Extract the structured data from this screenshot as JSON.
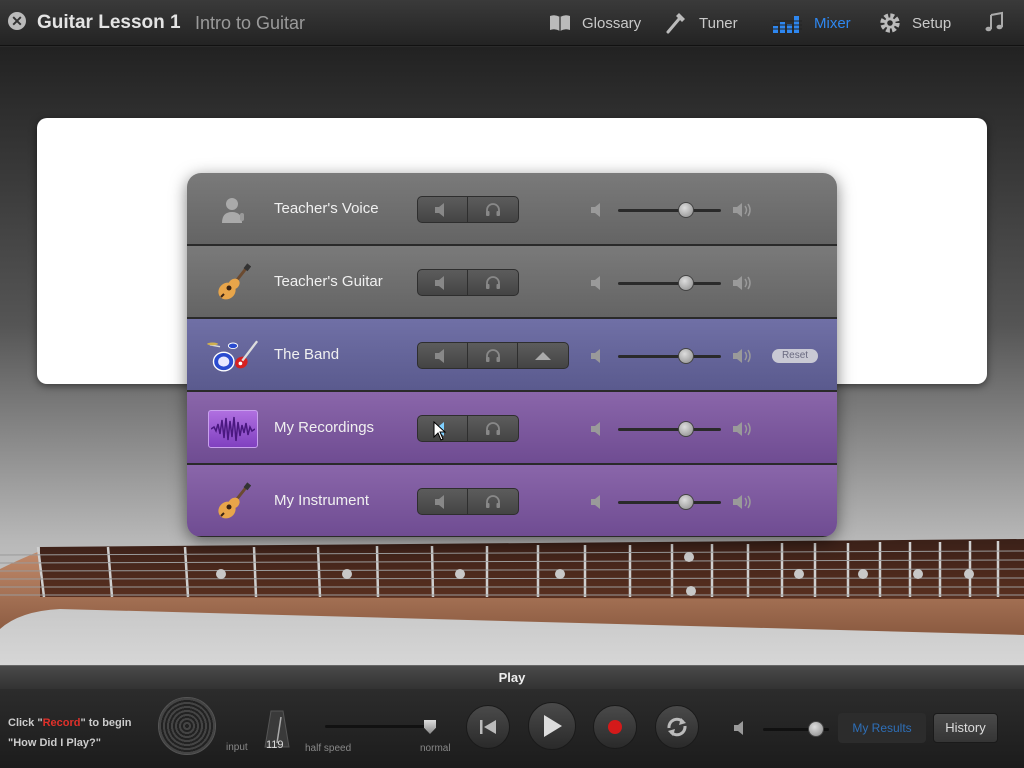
{
  "header": {
    "title": "Guitar Lesson 1",
    "subtitle": "Intro to Guitar",
    "nav": [
      {
        "label": "Glossary",
        "icon": "book-icon"
      },
      {
        "label": "Tuner",
        "icon": "tuning-fork-icon"
      },
      {
        "label": "Mixer",
        "icon": "mixer-bars-icon",
        "active": true
      },
      {
        "label": "Setup",
        "icon": "gear-icon"
      },
      {
        "label": "",
        "icon": "music-note-icon"
      }
    ],
    "accent_color": "#2e87f0"
  },
  "mixer": {
    "tracks": [
      {
        "name": "Teacher's Voice",
        "icon": "teacher-icon",
        "volume": 0.66,
        "style": "grey"
      },
      {
        "name": "Teacher's Guitar",
        "icon": "acoustic-guitar-icon",
        "volume": 0.66,
        "style": "grey"
      },
      {
        "name": "The Band",
        "icon": "band-icon",
        "volume": 0.66,
        "style": "band",
        "has_expand": true,
        "reset_label": "Reset"
      },
      {
        "name": "My Recordings",
        "icon": "waveform-icon",
        "volume": 0.66,
        "style": "purple"
      },
      {
        "name": "My Instrument",
        "icon": "acoustic-guitar-icon",
        "volume": 0.66,
        "style": "purple"
      }
    ]
  },
  "transport": {
    "play_label": "Play",
    "hint_prefix": "Click \"",
    "hint_keyword": "Record",
    "hint_suffix": "\" to begin",
    "hint_line2": "\"How Did I Play?\"",
    "input_label": "input",
    "tempo": "119",
    "half_speed_label": "half speed",
    "normal_label": "normal",
    "speed": 0.97,
    "volume": 0.8,
    "my_results_label": "My Results",
    "history_label": "History"
  }
}
